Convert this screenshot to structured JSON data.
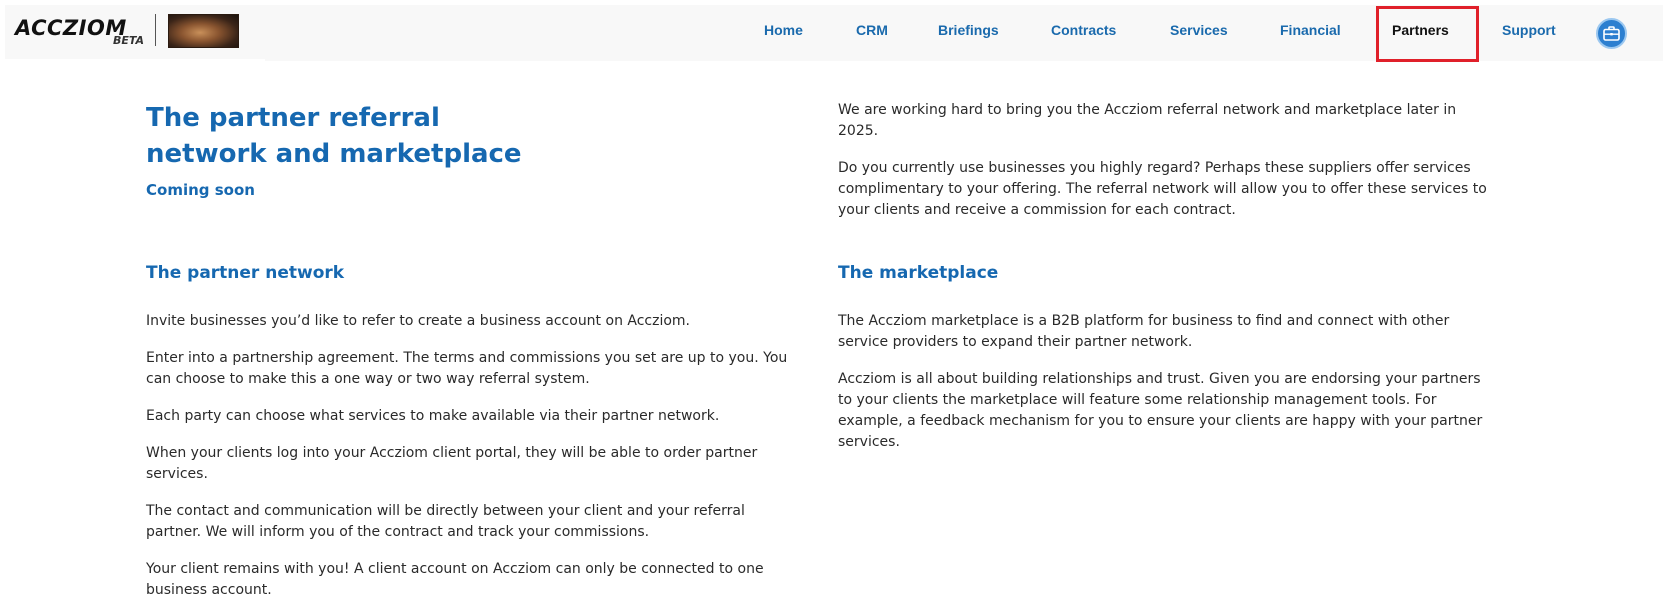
{
  "brand": {
    "name": "ACCZIOM",
    "tag": "BETA"
  },
  "nav": {
    "items": [
      {
        "label": "Home"
      },
      {
        "label": "CRM"
      },
      {
        "label": "Briefings"
      },
      {
        "label": "Contracts"
      },
      {
        "label": "Services"
      },
      {
        "label": "Financial"
      },
      {
        "label": "Partners",
        "active": true
      },
      {
        "label": "Support"
      }
    ],
    "account_icon": "briefcase-icon",
    "accent_color": "#1668b0",
    "highlight_color": "#e0202a"
  },
  "hero": {
    "title": "The partner referral network and marketplace",
    "subtitle": "Coming soon"
  },
  "intro": {
    "paragraphs": [
      "We are working hard to bring you the Accziom referral network and marketplace later in 2025.",
      "Do you currently use businesses you highly regard? Perhaps these suppliers offer services complimentary to your offering. The referral network will allow you to offer these services to your clients and receive a commission for each contract."
    ]
  },
  "partner_network": {
    "title": "The partner network",
    "paragraphs": [
      "Invite businesses you’d like to refer to create a business account on Accziom.",
      "Enter into a partnership agreement. The terms and commissions you set are up to you. You can choose to make this a one way or two way referral system.",
      "Each party can choose what services to make available via their partner network.",
      "When your clients log into your Accziom client portal, they will be able to order partner services.",
      "The contact and communication will be directly between your client and your referral partner. We will inform you of the contract and track your commissions.",
      "Your client remains with you! A client account on Accziom can only be connected to one business account."
    ]
  },
  "marketplace": {
    "title": "The marketplace",
    "paragraphs": [
      "The Accziom marketplace is a B2B platform for business to find and connect with other service providers to expand their partner network.",
      "Accziom is all about building relationships and trust. Given you are endorsing your partners to your clients the marketplace will feature some relationship management tools. For example, a feedback mechanism for you to ensure your clients are happy with your partner services."
    ]
  }
}
